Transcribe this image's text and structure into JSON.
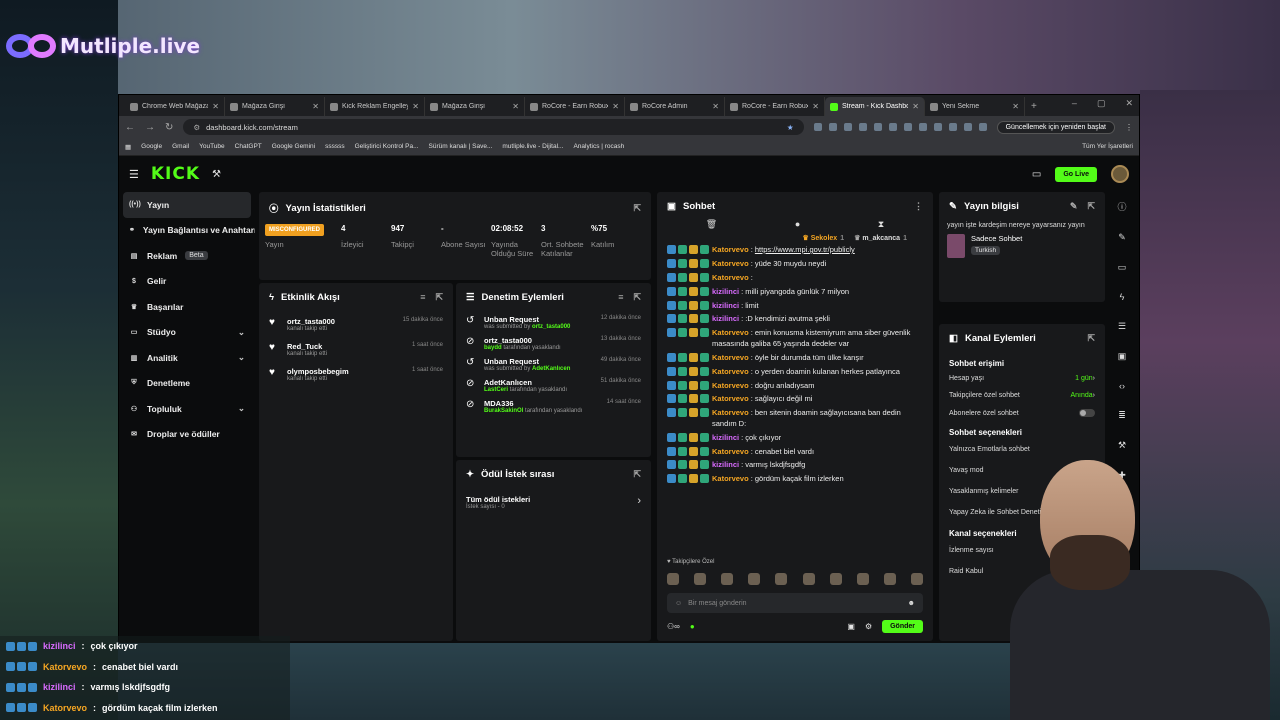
{
  "overlay_logo": "Mutliple.live",
  "browser": {
    "tabs": [
      {
        "label": "Chrome Web Mağazası",
        "active": false
      },
      {
        "label": "Mağaza Girişi",
        "active": false
      },
      {
        "label": "Kick Reklam Engelleyici",
        "active": false
      },
      {
        "label": "Mağaza Girişi",
        "active": false
      },
      {
        "label": "RoCore - Earn Robux",
        "active": false
      },
      {
        "label": "RoCore Admin",
        "active": false
      },
      {
        "label": "RoCore - Earn Robux",
        "active": false
      },
      {
        "label": "Stream - Kick Dashboard",
        "active": true
      },
      {
        "label": "Yeni Sekme",
        "active": false
      }
    ],
    "url": "dashboard.kick.com/stream",
    "update_button": "Güncellemek için yeniden başlat",
    "bookmarks": [
      "Google",
      "Gmail",
      "YouTube",
      "ChatGPT",
      "Google Gemini",
      "ssssss",
      "Geliştirici Kontrol Pa...",
      "Sürüm kanalı | Save...",
      "mutliple.live - Dijital...",
      "Analytics | rocash"
    ],
    "bookmarks_right": "Tüm Yer İşaretleri"
  },
  "kick": {
    "logo": "KICK",
    "go_live": "Go Live",
    "sidebar": [
      {
        "label": "Yayın",
        "icon": "broadcast-icon",
        "active": true,
        "chev": false
      },
      {
        "label": "Yayın Bağlantısı ve Anahtarı",
        "icon": "link-icon",
        "active": false,
        "chev": false
      },
      {
        "label": "Reklam",
        "icon": "ad-icon",
        "active": false,
        "chev": false,
        "badge": "Beta"
      },
      {
        "label": "Gelir",
        "icon": "dollar-icon",
        "active": false,
        "chev": false
      },
      {
        "label": "Başarılar",
        "icon": "trophy-icon",
        "active": false,
        "chev": false
      },
      {
        "label": "Stüdyo",
        "icon": "studio-icon",
        "active": false,
        "chev": true
      },
      {
        "label": "Analitik",
        "icon": "chart-icon",
        "active": false,
        "chev": true
      },
      {
        "label": "Denetleme",
        "icon": "shield-icon",
        "active": false,
        "chev": false
      },
      {
        "label": "Topluluk",
        "icon": "people-icon",
        "active": false,
        "chev": true
      },
      {
        "label": "Droplar ve ödüller",
        "icon": "gift-icon",
        "active": false,
        "chev": false
      }
    ],
    "stats": {
      "title": "Yayın İstatistikleri",
      "items": [
        {
          "value": "MISCONFIGURED",
          "label": "Yayın",
          "badge": true
        },
        {
          "value": "4",
          "label": "İzleyici"
        },
        {
          "value": "947",
          "label": "Takipçi"
        },
        {
          "value": "-",
          "label": "Abone Sayısı"
        },
        {
          "value": "02:08:52",
          "label": "Yayında Olduğu Süre"
        },
        {
          "value": "3",
          "label": "Ort. Sohbete Katılanlar"
        },
        {
          "value": "%75",
          "label": "Katılım"
        }
      ]
    },
    "activity": {
      "title": "Etkinlik Akışı",
      "items": [
        {
          "name": "ortz_tasta000",
          "sub": "kanalı takip etti",
          "time": "15 dakika önce"
        },
        {
          "name": "Red_Tuck",
          "sub": "kanalı takip etti",
          "time": "1 saat önce"
        },
        {
          "name": "olymposbebegim",
          "sub": "kanalı takip etti",
          "time": "1 saat önce"
        }
      ]
    },
    "moderation": {
      "title": "Denetim Eylemleri",
      "items": [
        {
          "title": "Unban Request",
          "pre": "was submitted by ",
          "who": "ortz_tasta000",
          "post": "",
          "time": "12 dakika önce"
        },
        {
          "title": "ortz_tasta000",
          "pre": "",
          "who": "baydd",
          "post": " tarafından yasaklandı",
          "time": "13 dakika önce"
        },
        {
          "title": "Unban Request",
          "pre": "was submitted by ",
          "who": "AdetKanlıcen",
          "post": "",
          "time": "49 dakika önce"
        },
        {
          "title": "AdetKanlıcen",
          "pre": "",
          "who": "LastCeri",
          "post": " tarafından yasaklandı",
          "time": "51 dakika önce"
        },
        {
          "title": "MDA336",
          "pre": "",
          "who": "BurakSakinOl",
          "post": " tarafından yasaklandı",
          "time": "14 saat önce"
        }
      ]
    },
    "rewards": {
      "title": "Ödül İstek sırası",
      "item": "Tüm ödül istekleri",
      "count": "İstek sayısı - 0"
    },
    "chat": {
      "title": "Sohbet",
      "top_users": [
        {
          "name": "Sekolex",
          "n": "1"
        },
        {
          "name": "m_akcanca",
          "n": "1"
        }
      ],
      "messages": [
        {
          "u": "Katorvevo",
          "c": "o",
          "t": "https://www.mpi.gov.tr/publicly"
        },
        {
          "u": "Katorvevo",
          "c": "o",
          "t": "yüde 30 muydu neydi"
        },
        {
          "u": "Katorvevo",
          "c": "o",
          "t": ""
        },
        {
          "u": "kizilinci",
          "c": "p",
          "t": "milli piyangoda günlük 7 milyon"
        },
        {
          "u": "kizilinci",
          "c": "p",
          "t": "limit"
        },
        {
          "u": "kizilinci",
          "c": "p",
          "t": ":D kendimizi avutma şekli"
        },
        {
          "u": "Katorvevo",
          "c": "o",
          "t": "emin konusma kistemiyrum ama siber güvenlik masasında galiba 65 yaşında dedeler var"
        },
        {
          "u": "Katorvevo",
          "c": "o",
          "t": "öyle bir durumda tüm ülke kanşır"
        },
        {
          "u": "Katorvevo",
          "c": "o",
          "t": "o yerden doamin kulanan herkes patlayınca"
        },
        {
          "u": "Katorvevo",
          "c": "o",
          "t": "doğru anladıysam"
        },
        {
          "u": "Katorvevo",
          "c": "o",
          "t": "sağlayıcı değil mi"
        },
        {
          "u": "Katorvevo",
          "c": "o",
          "t": "ben sitenin doamin sağlayıcısana ban dedin sandım D:"
        },
        {
          "u": "kizilinci",
          "c": "p",
          "t": "çok çıkıyor"
        },
        {
          "u": "Katorvevo",
          "c": "o",
          "t": "cenabet biel vardı"
        },
        {
          "u": "kizilinci",
          "c": "p",
          "t": "varmış lskdjfsgdfg"
        },
        {
          "u": "Katorvevo",
          "c": "o",
          "t": "gördüm kaçak film izlerken"
        }
      ],
      "followers_only": "Takipçilere Özel",
      "placeholder": "Bir mesaj gönderin",
      "send": "Gönder"
    },
    "stream_info": {
      "title": "Yayın bilgisi",
      "stream_title": "yayın işte kardeşim nereye yayarsanız yayın",
      "category": "Sadece Sohbet",
      "language": "Turkish"
    },
    "channel_actions": {
      "title": "Kanal Eylemleri",
      "chat_access": "Sohbet erişimi",
      "rows": [
        {
          "label": "Hesap yaşı",
          "value": "1 gün",
          "type": "value"
        },
        {
          "label": "Takipçilere özel sohbet",
          "value": "Anında",
          "type": "value"
        },
        {
          "label": "Abonelere özel sohbet",
          "value": "",
          "type": "toggle"
        }
      ],
      "chat_options": "Sohbet seçenekleri",
      "options": [
        "Yalnızca Emotlarla sohbet",
        "Yavaş mod",
        "Yasaklanmış kelimeler",
        "Yapay Zeka ile Sohbet Denetimi"
      ],
      "channel_options": "Kanal seçenekleri",
      "channel_rows": [
        "İzlenme sayısı",
        "Raid Kabul"
      ]
    }
  },
  "overlay_chat": [
    {
      "u": "kizilinci",
      "t": "çok çıkıyor"
    },
    {
      "u": "Katorvevo",
      "t": "cenabet biel vardı"
    },
    {
      "u": "kizilinci",
      "t": "varmış lskdjfsgdfg"
    },
    {
      "u": "Katorvevo",
      "t": "gördüm kaçak film izlerken"
    }
  ]
}
